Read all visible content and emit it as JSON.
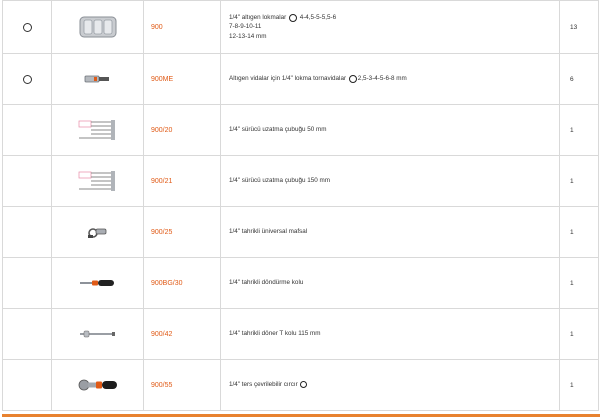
{
  "items": [
    {
      "code": "900",
      "desc_lines": [
        "1/4\" altıgen lokmalar",
        "4-4,5-5-5,5-6",
        "7-8-9-10-11",
        "12-13-14 mm"
      ],
      "has_icon": true,
      "qty": "13",
      "image": "socket-icon"
    },
    {
      "code": "900ME",
      "desc_lines": [
        "Altıgen vidalar için 1/4\" lokma tornavidalar",
        "2,5-3-4-5-6-8 mm"
      ],
      "has_icon": true,
      "qty": "6",
      "image": "screwdriver-bit-socket-icon"
    },
    {
      "code": "900/20",
      "desc_lines": [
        "1/4\" sürücü uzatma çubuğu 50 mm"
      ],
      "qty": "1",
      "image": "extension-bar-icon"
    },
    {
      "code": "900/21",
      "desc_lines": [
        "1/4\" sürücü uzatma çubuğu 150 mm"
      ],
      "qty": "1",
      "image": "extension-bar-icon"
    },
    {
      "code": "900/25",
      "desc_lines": [
        "1/4\" tahrikli üniversal mafsal"
      ],
      "qty": "1",
      "image": "universal-joint-icon"
    },
    {
      "code": "900BG/30",
      "desc_lines": [
        "1/4\" tahrikli döndürme kolu"
      ],
      "qty": "1",
      "image": "spinner-handle-icon"
    },
    {
      "code": "900/42",
      "desc_lines": [
        "1/4\" tahrikli döner T kolu 115 mm"
      ],
      "qty": "1",
      "image": "t-handle-icon"
    },
    {
      "code": "900/55",
      "desc_lines": [
        "1/4\" ters çevrilebilir cırcır"
      ],
      "has_ratchet_icon": true,
      "qty": "1",
      "image": "ratchet-icon"
    }
  ],
  "colors": {
    "code": "#e05a16",
    "accent_bar": "#e8822f",
    "grid": "#d9d9d9"
  }
}
